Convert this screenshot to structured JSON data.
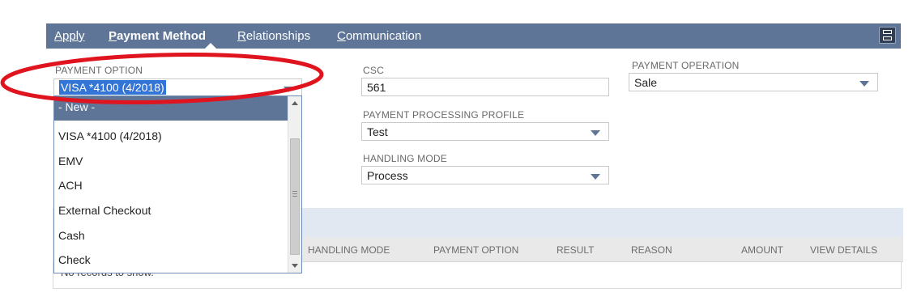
{
  "tabs": [
    {
      "accel": "A",
      "rest": "pply"
    },
    {
      "accel": "P",
      "rest": "ayment Method"
    },
    {
      "accel": "R",
      "rest": "elationships"
    },
    {
      "accel": "C",
      "rest": "ommunication"
    }
  ],
  "fields": {
    "payment_option": {
      "label": "PAYMENT OPTION",
      "value": "VISA *4100 (4/2018)"
    },
    "csc": {
      "label": "CSC",
      "value": "561"
    },
    "payment_processing_profile": {
      "label": "PAYMENT PROCESSING PROFILE",
      "value": "Test"
    },
    "handling_mode": {
      "label": "HANDLING MODE",
      "value": "Process"
    },
    "payment_operation": {
      "label": "PAYMENT OPERATION",
      "value": "Sale"
    }
  },
  "dropdown": {
    "options": [
      "- New -",
      "VISA *4100 (4/2018)",
      "EMV",
      "ACH",
      "External Checkout",
      "Cash",
      "Check"
    ],
    "highlighted": "- New -"
  },
  "table": {
    "columns": [
      "HANDLING MODE",
      "PAYMENT OPTION",
      "RESULT",
      "REASON",
      "AMOUNT",
      "VIEW DETAILS"
    ],
    "empty_text": "No records to show."
  },
  "colors": {
    "tabbar": "#5f7597",
    "highlight": "#5f7597",
    "annotation": "#e0141e"
  },
  "icons": {
    "menu": "list-view-icon",
    "select_caret": "caret-down-icon"
  }
}
